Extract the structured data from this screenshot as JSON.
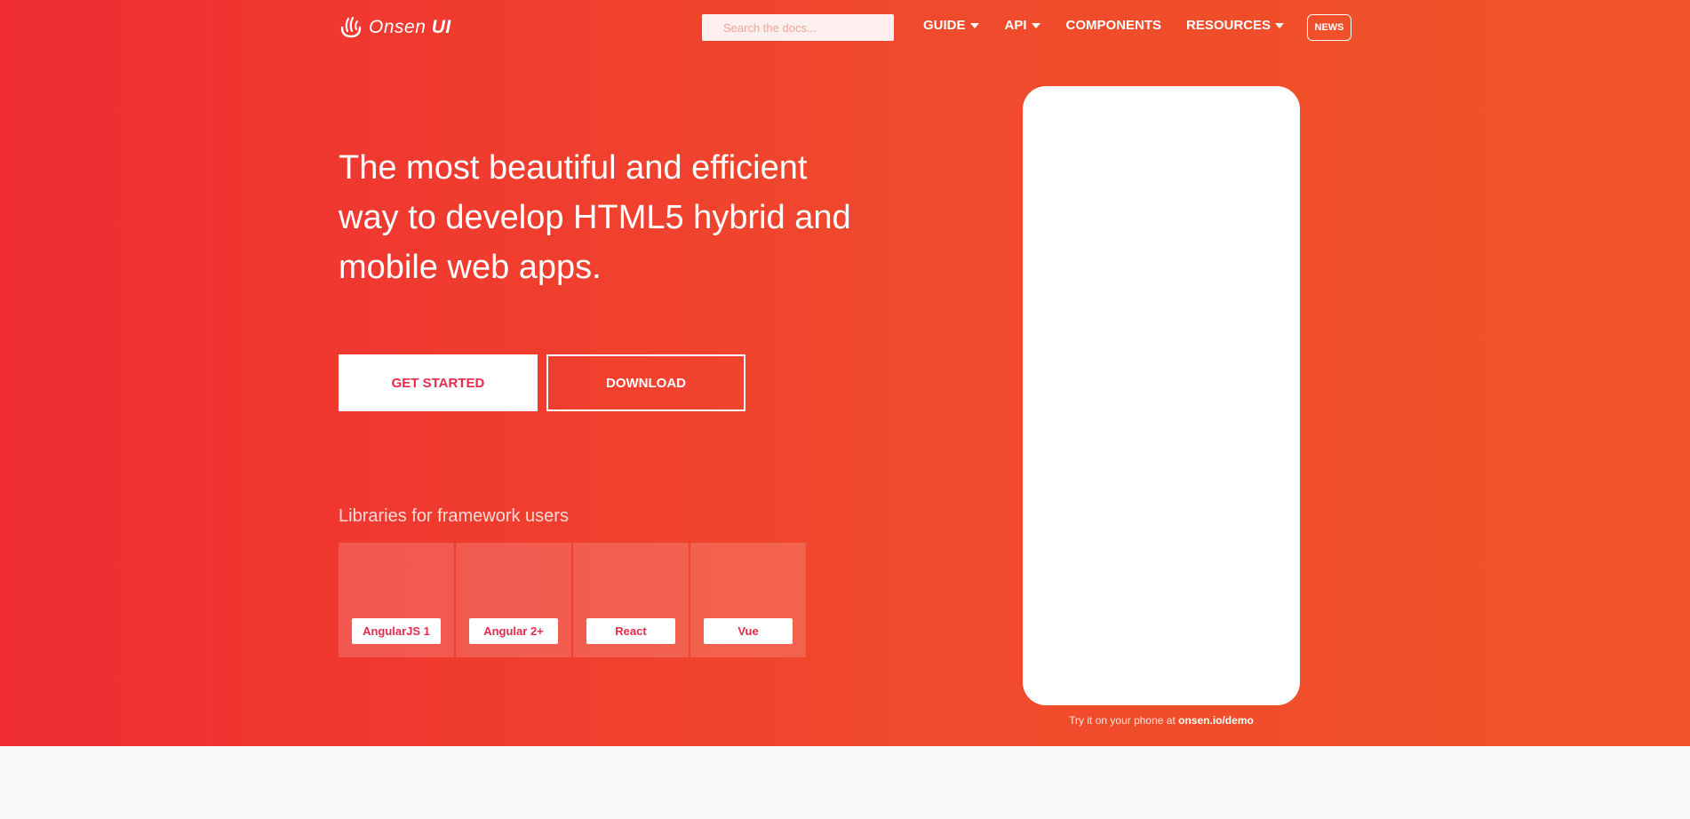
{
  "header": {
    "logo_text": "Onsen",
    "logo_text_bold": "UI",
    "search_placeholder": "Search the docs...",
    "nav": [
      {
        "label": "GUIDE",
        "dropdown": true
      },
      {
        "label": "API",
        "dropdown": true
      },
      {
        "label": "COMPONENTS",
        "dropdown": false
      },
      {
        "label": "RESOURCES",
        "dropdown": true
      }
    ],
    "news_label": "NEWS"
  },
  "hero": {
    "headline": "The most beautiful and efficient way to develop HTML5 hybrid and mobile web apps.",
    "get_started_label": "GET STARTED",
    "download_label": "DOWNLOAD",
    "libraries_title": "Libraries for framework users",
    "libraries": [
      {
        "label": "AngularJS 1",
        "icon": "angularjs-icon"
      },
      {
        "label": "Angular 2+",
        "icon": "angular-icon"
      },
      {
        "label": "React",
        "icon": "react-icon"
      },
      {
        "label": "Vue",
        "icon": "vue-icon"
      }
    ],
    "demo_caption": "Try it on your phone at",
    "demo_link": "onsen.io/demo"
  },
  "colors": {
    "gradient_start": "#ef2d32",
    "gradient_end": "#f05428",
    "accent_text": "#e8294a",
    "page_bg": "#f8f8fa"
  }
}
